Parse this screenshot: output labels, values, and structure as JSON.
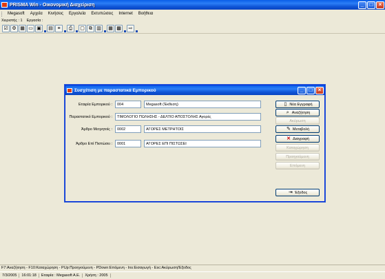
{
  "window": {
    "title": "PRISMA Win - Οικονομική Διαχείριση"
  },
  "menu": [
    "Megasoft",
    "Αρχεία",
    "Κινήσεις",
    "Εργαλεία",
    "Εκτυπώσεις",
    "Internet",
    "Βοήθεια"
  ],
  "info": {
    "user": "Χειριστής : 1",
    "tools": "Εργασία :"
  },
  "dialog": {
    "title": "Συσχέτιση με παραστατικά Εμπορικού",
    "fields": [
      {
        "label": "Εταιρία Εμπορικού :",
        "code": "004",
        "desc": "Megasoft (Έκθεση)"
      },
      {
        "label": "Παραστατικό Εμπορικού :",
        "value": "ΤΙΜΟΛΟΓΙΟ ΠΩΛΗΣΗΣ - ΔΕΛΤΙΟ ΑΠΟΣΤΟΛΗΣ Αγορές"
      },
      {
        "label": "Άρθρο Μετρητοίς :",
        "code": "0002",
        "desc": "ΑΓΟΡΕΣ ΜΕΤΡΗΤΟΙΣ"
      },
      {
        "label": "Άρθρο Επί Πιστώσει :",
        "code": "0001",
        "desc": "ΑΓΟΡΕΣ ΕΠΙ ΠΙΣΤΩΣΕΙ"
      }
    ],
    "buttons": {
      "new": "Νέα Εγγραφή",
      "search": "Αναζήτηση",
      "cancel": "Ακύρωση",
      "edit": "Μεταβολή",
      "delete": "Διαγραφή",
      "save": "Καταχώρηση",
      "prev": "Προηγούμενη",
      "next": "Επόμενη",
      "exit": "Έξοδος"
    }
  },
  "hotkeys": "F7:Αναζήτηση - F10:Καταχώρηση - PUp:Προηγούμενη - PDown:Επόμενη - Ins:Εισαγωγή - Esc:Ακύρωση/Έξοδος",
  "status": {
    "date": "7/3/2005",
    "time": "16:01:18",
    "company": "Εταιρία : Megasoft A.E.",
    "year": "Χρήση : 2005"
  }
}
